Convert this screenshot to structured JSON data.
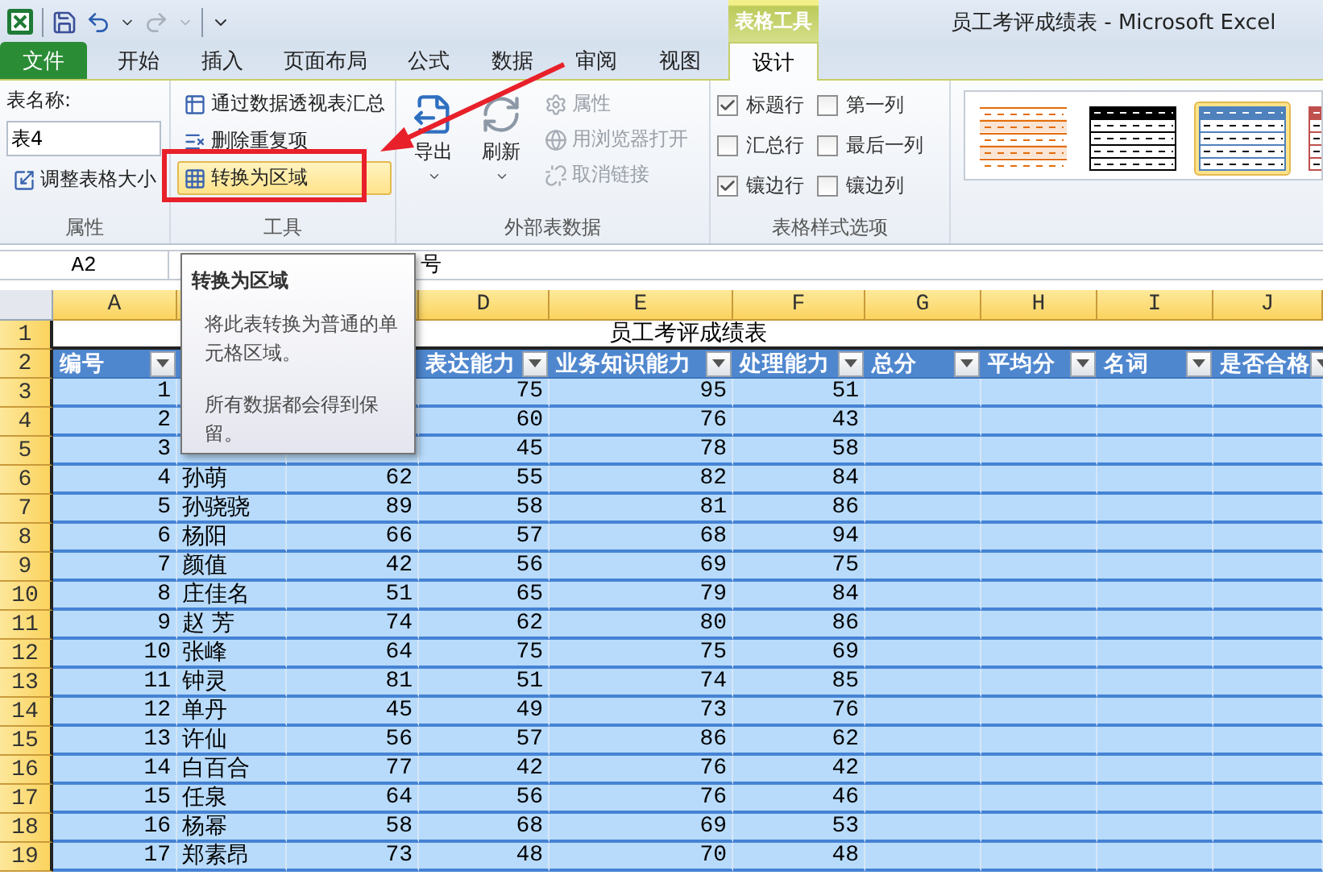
{
  "window": {
    "title": "员工考评成绩表  -  Microsoft Excel",
    "context_label": "表格工具"
  },
  "tabs": [
    {
      "label": "文件",
      "kind": "file",
      "selected": false
    },
    {
      "label": "开始",
      "kind": "tab",
      "selected": false
    },
    {
      "label": "插入",
      "kind": "tab",
      "selected": false
    },
    {
      "label": "页面布局",
      "kind": "tab",
      "selected": false
    },
    {
      "label": "公式",
      "kind": "tab",
      "selected": false
    },
    {
      "label": "数据",
      "kind": "tab",
      "selected": false
    },
    {
      "label": "审阅",
      "kind": "tab",
      "selected": false
    },
    {
      "label": "视图",
      "kind": "tab",
      "selected": false
    },
    {
      "label": "设计",
      "kind": "context",
      "selected": true
    }
  ],
  "ribbon": {
    "properties_group": {
      "label": "属性",
      "name_label": "表名称:",
      "name_value": "表4",
      "resize": "调整表格大小"
    },
    "tools_group": {
      "label": "工具",
      "items": [
        {
          "label": "通过数据透视表汇总",
          "highlighted": false
        },
        {
          "label": "删除重复项",
          "highlighted": false
        },
        {
          "label": "转换为区域",
          "highlighted": true
        }
      ]
    },
    "external_group": {
      "label": "外部表数据",
      "large": [
        {
          "label": "导出"
        },
        {
          "label": "刷新"
        }
      ],
      "small": [
        {
          "label": "属性",
          "disabled": true
        },
        {
          "label": "用浏览器打开",
          "disabled": true
        },
        {
          "label": "取消链接",
          "disabled": true
        }
      ]
    },
    "options_group": {
      "label": "表格样式选项",
      "checks": [
        {
          "label": "标题行",
          "checked": true
        },
        {
          "label": "汇总行",
          "checked": false
        },
        {
          "label": "镶边行",
          "checked": true
        },
        {
          "label": "第一列",
          "checked": false
        },
        {
          "label": "最后一列",
          "checked": false
        },
        {
          "label": "镶边列",
          "checked": false
        }
      ]
    },
    "styles": [
      {
        "kind": "light",
        "color": "#e46c0a",
        "selected": false
      },
      {
        "kind": "medium",
        "color": "#000000",
        "selected": false
      },
      {
        "kind": "medium",
        "color": "#4f81bd",
        "selected": true
      },
      {
        "kind": "medium",
        "color": "#c0504d",
        "selected": false
      }
    ]
  },
  "formula_bar": {
    "name_box": "A2",
    "value": "号"
  },
  "grid": {
    "highlighted": true,
    "columns": [
      "A",
      "D",
      "E",
      "F",
      "G",
      "H",
      "I",
      "J"
    ],
    "title_row": {
      "number": "1",
      "title": "员工考评成绩表"
    },
    "header_row": {
      "number": "2",
      "headers": [
        "编号",
        "表达能力",
        "业务知识能力",
        "处理能力",
        "总分",
        "平均分",
        "名词",
        "是否合格"
      ]
    },
    "rows": [
      {
        "number": "3",
        "cells": [
          "1",
          "75",
          "95",
          "51"
        ]
      },
      {
        "number": "4",
        "cells": [
          "2",
          "60",
          "76",
          "43"
        ]
      },
      {
        "number": "5",
        "cells": [
          "3",
          "45",
          "78",
          "58"
        ]
      },
      {
        "number": "6",
        "cells": [
          "4",
          "孙萌",
          "62",
          "55",
          "82",
          "84"
        ]
      },
      {
        "number": "7",
        "cells": [
          "5",
          "孙骁骁",
          "89",
          "58",
          "81",
          "86"
        ]
      },
      {
        "number": "8",
        "cells": [
          "6",
          "杨阳",
          "66",
          "57",
          "68",
          "94"
        ]
      },
      {
        "number": "9",
        "cells": [
          "7",
          "颜值",
          "42",
          "56",
          "69",
          "75"
        ]
      },
      {
        "number": "10",
        "cells": [
          "8",
          "庄佳名",
          "51",
          "65",
          "79",
          "84"
        ]
      },
      {
        "number": "11",
        "cells": [
          "9",
          "赵 芳",
          "74",
          "62",
          "80",
          "86"
        ]
      },
      {
        "number": "12",
        "cells": [
          "10",
          "张峰",
          "64",
          "75",
          "75",
          "69"
        ]
      },
      {
        "number": "13",
        "cells": [
          "11",
          "钟灵",
          "81",
          "51",
          "74",
          "85"
        ]
      },
      {
        "number": "14",
        "cells": [
          "12",
          "单丹",
          "45",
          "49",
          "73",
          "76"
        ]
      },
      {
        "number": "15",
        "cells": [
          "13",
          "许仙",
          "56",
          "57",
          "86",
          "62"
        ]
      },
      {
        "number": "16",
        "cells": [
          "14",
          "白百合",
          "77",
          "42",
          "76",
          "42"
        ]
      },
      {
        "number": "17",
        "cells": [
          "15",
          "任泉",
          "64",
          "56",
          "76",
          "46"
        ]
      },
      {
        "number": "18",
        "cells": [
          "16",
          "杨幂",
          "58",
          "68",
          "69",
          "53"
        ]
      },
      {
        "number": "19",
        "cells": [
          "17",
          "郑素昂",
          "73",
          "48",
          "70",
          "48"
        ]
      }
    ]
  },
  "tooltip": {
    "title": "转换为区域",
    "paragraphs": [
      "将此表转换为普通的单元格区域。",
      "所有数据都会得到保留。"
    ]
  },
  "annotation": {
    "arrow": true,
    "frame": true
  }
}
